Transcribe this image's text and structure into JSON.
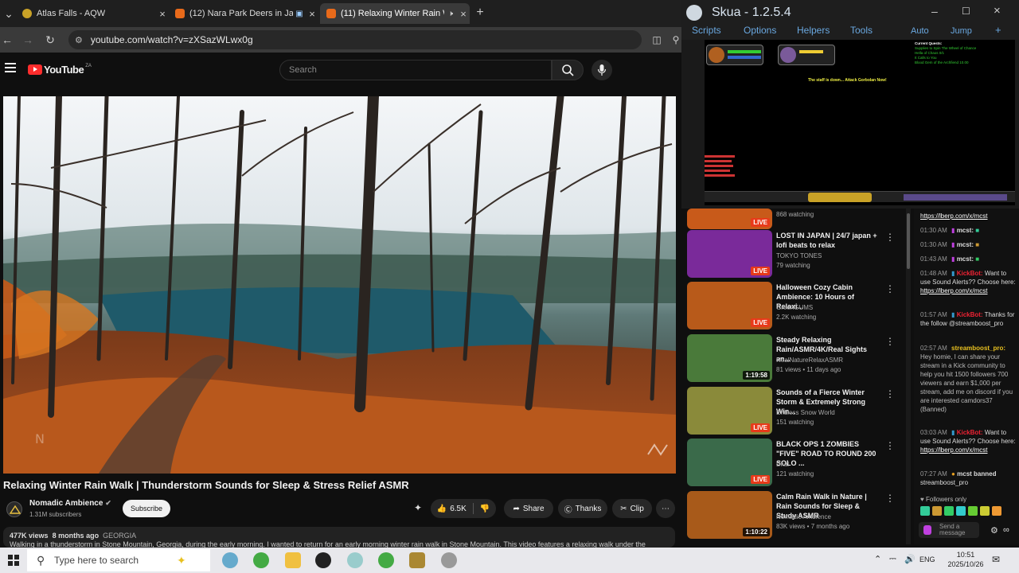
{
  "browser": {
    "tabs": [
      {
        "title": "Atlas Falls - AQW",
        "color": "#c9a227",
        "active": false
      },
      {
        "title": "(12) Nara Park Deers in Jap",
        "color": "#e86a1a",
        "active": false
      },
      {
        "title": "(11) Relaxing Winter Rain W",
        "color": "#e86a1a",
        "active": true
      }
    ],
    "new_tab": "+",
    "url": "youtube.com/watch?v=zXSazWLwx0g"
  },
  "youtube": {
    "logo_text": "YouTube",
    "country": "ZA",
    "search_placeholder": "Search",
    "video_title": "Relaxing Winter Rain Walk | Thunderstorm Sounds for Sleep & Stress Relief ASMR",
    "channel_name": "Nomadic Ambience",
    "subscribers": "1.31M subscribers",
    "subscribe_label": "Subscribe",
    "likes": "6.5K",
    "share_label": "Share",
    "thanks_label": "Thanks",
    "clip_label": "Clip",
    "views": "477K views",
    "age": "8 months ago",
    "tag": "GEORGIA",
    "description": "Walking in a thunderstorm in Stone Mountain, Georgia, during the early morning. I wanted to return for an early morning winter rain walk in Stone Mountain. This video features a relaxing walk under the"
  },
  "skua": {
    "title": "Skua - 1.2.5.4",
    "menu": [
      "Scripts",
      "Options",
      "Helpers",
      "Tools"
    ],
    "menu_right": [
      "Auto",
      "Jump",
      "+"
    ],
    "game_notice": "The staff is down... Attack Gorbolan Now!",
    "quest_title": "Current Quests:",
    "quest_lines": [
      "Supplies to Spin The Wheel of Chance",
      "Hella of Chaos 0/1",
      "It Calls to You",
      "Blood Gem of the Archfiend 10.00"
    ]
  },
  "recommendations": [
    {
      "title": "",
      "channel": "",
      "meta": "868 watching",
      "badge": "LIVE",
      "thumb": "#c85a1a"
    },
    {
      "title": "LOST IN JAPAN | 24/7 japan + lofi beats to relax",
      "channel": "TOKYO TONES",
      "meta": "79 watching",
      "badge": "LIVE",
      "thumb": "#7a2a9a"
    },
    {
      "title": "Halloween Cozy Cabin Ambience: 10 Hours of Relaxi...",
      "channel": "GreenGUMS",
      "meta": "2.2K watching",
      "badge": "LIVE",
      "thumb": "#b85a1a"
    },
    {
      "title": "Steady Relaxing Rain/ASMR/4K/Real Sights an...",
      "channel": "RealNatureRelaxASMR",
      "meta": "81 views • 11 days ago",
      "badge": "1:19:58",
      "thumb": "#4a7a3a"
    },
    {
      "title": "Sounds of a Fierce Winter Storm & Extremely Strong Win...",
      "channel": "Endless Snow World",
      "meta": "151 watching",
      "badge": "LIVE",
      "thumb": "#8a8a3a"
    },
    {
      "title": "BLACK OPS 1 ZOMBIES \"FIVE\" ROAD TO ROUND 200 SOLO ...",
      "channel": "Dkal",
      "meta": "121 watching",
      "badge": "LIVE",
      "thumb": "#3a6a4a"
    },
    {
      "title": "Calm Rain Walk in Nature | Rain Sounds for Sleep & Study ASMR",
      "channel": "Nomadic Ambience",
      "meta": "83K views • 7 months ago",
      "badge": "1:10:22",
      "thumb": "#a85a1a"
    }
  ],
  "chat": {
    "messages": [
      {
        "time": "",
        "user": "",
        "text": "https://lberp.com/x/mcst",
        "link": true
      },
      {
        "time": "01:30 AM",
        "user": "mcst:",
        "text": ""
      },
      {
        "time": "01:30 AM",
        "user": "mcst:",
        "text": ""
      },
      {
        "time": "01:43 AM",
        "user": "mcst:",
        "text": ""
      },
      {
        "time": "01:48 AM",
        "user": "KickBot:",
        "text": "Want to use Sound Alerts?? Choose here:",
        "link_text": "https://lberp.com/x/mcst"
      },
      {
        "time": "01:57 AM",
        "user": "KickBot:",
        "text": "Thanks for the follow @streamboost_pro"
      },
      {
        "time": "02:57 AM",
        "user": "streamboost_pro:",
        "text": "Hey homie, I can share your stream in a Kick community to help you hit 1500 followers 700 viewers and earn $1,000 per stream, add me on discord if you are interested camdors37 (Banned)"
      },
      {
        "time": "03:03 AM",
        "user": "KickBot:",
        "text": "Want to use Sound Alerts?? Choose here:",
        "link_text": "https://lberp.com/x/mcst"
      },
      {
        "time": "07:27 AM",
        "user": "mcst banned",
        "text": "streamboost_pro"
      }
    ],
    "followers_only": "Followers only",
    "send_placeholder": "Send a message"
  },
  "taskbar": {
    "search_placeholder": "Type here to search",
    "lang": "ENG",
    "time": "10:51",
    "date": "2025/10/26"
  }
}
